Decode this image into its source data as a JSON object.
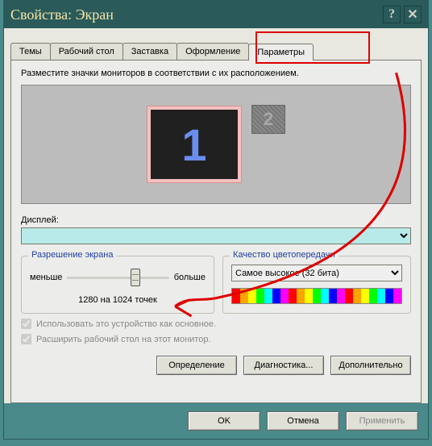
{
  "title": "Свойства: Экран",
  "tabs": {
    "themes": "Темы",
    "desktop": "Рабочий стол",
    "screensaver": "Заставка",
    "appearance": "Оформление",
    "settings": "Параметры"
  },
  "instruction": "Разместите значки мониторов в соответствии с их расположением.",
  "monitor1": "1",
  "monitor2": "2",
  "display_label": "Дисплей:",
  "display_value": "",
  "res": {
    "group_title": "Разрешение экрана",
    "less": "меньше",
    "more": "больше",
    "value": "1280 на 1024 точек"
  },
  "color": {
    "group_title": "Качество цветопередачи",
    "value": "Самое высокое (32 бита)"
  },
  "check1": "Использовать это устройство как основное.",
  "check2": "Расширить рабочий стол на этот монитор.",
  "btn_identify": "Определение",
  "btn_diag": "Диагностика...",
  "btn_adv": "Дополнительно",
  "footer": {
    "ok": "OK",
    "cancel": "Отмена",
    "apply": "Применить"
  }
}
